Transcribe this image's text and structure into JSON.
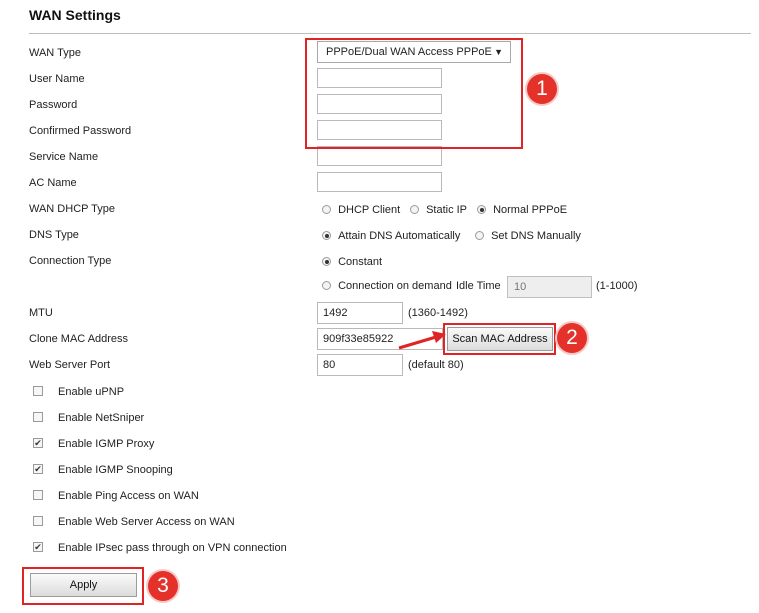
{
  "title": "WAN Settings",
  "labels": {
    "wan_type": "WAN Type",
    "user_name": "User Name",
    "password": "Password",
    "confirmed_password": "Confirmed Password",
    "service_name": "Service Name",
    "ac_name": "AC Name",
    "wan_dhcp_type": "WAN DHCP Type",
    "dns_type": "DNS Type",
    "connection_type": "Connection Type",
    "mtu": "MTU",
    "clone_mac": "Clone MAC Address",
    "web_server_port": "Web Server Port"
  },
  "wan_type": {
    "selected": "PPPoE/Dual WAN Access PPPoE"
  },
  "dhcp_options": [
    {
      "label": "DHCP Client",
      "selected": false
    },
    {
      "label": "Static IP",
      "selected": false
    },
    {
      "label": "Normal PPPoE",
      "selected": true
    }
  ],
  "dns_options": [
    {
      "label": "Attain DNS Automatically",
      "selected": true
    },
    {
      "label": "Set DNS Manually",
      "selected": false
    }
  ],
  "connection_options": [
    {
      "label": "Constant",
      "selected": true
    },
    {
      "label": "Connection on demand",
      "selected": false
    }
  ],
  "idle_time": {
    "label": "Idle Time",
    "value": "10",
    "range": "(1-1000)"
  },
  "mtu": {
    "value": "1492",
    "hint": "(1360-1492)"
  },
  "clone_mac": {
    "value": "909f33e85922",
    "button": "Scan MAC Address"
  },
  "web_server_port": {
    "value": "80",
    "hint": "(default 80)"
  },
  "checkboxes": [
    {
      "label": "Enable uPNP",
      "checked": false
    },
    {
      "label": "Enable NetSniper",
      "checked": false
    },
    {
      "label": "Enable IGMP Proxy",
      "checked": true
    },
    {
      "label": "Enable IGMP Snooping",
      "checked": true
    },
    {
      "label": "Enable Ping Access on WAN",
      "checked": false
    },
    {
      "label": "Enable Web Server Access on WAN",
      "checked": false
    },
    {
      "label": "Enable IPsec pass through on VPN connection",
      "checked": true
    }
  ],
  "apply_label": "Apply",
  "annotations": [
    "1",
    "2",
    "3"
  ],
  "colors": {
    "annotation_red": "#e02424",
    "badge_red": "#e4322b"
  }
}
